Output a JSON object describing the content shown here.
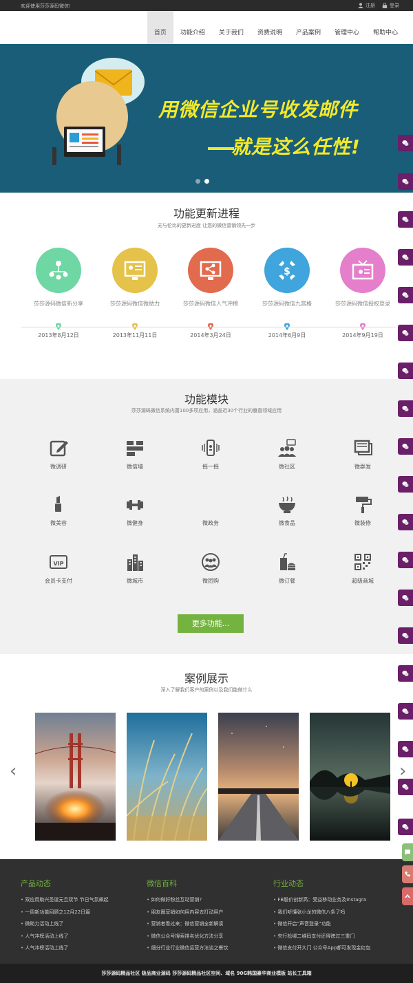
{
  "topbar": {
    "welcome": "欢迎使用莎莎源码微信!",
    "register": "注册",
    "login": "登录"
  },
  "nav": {
    "items": [
      "首页",
      "功能介绍",
      "关于我们",
      "资费说明",
      "产品案例",
      "管理中心",
      "帮助中心"
    ],
    "active": "首页"
  },
  "banner": {
    "line1": "用微信企业号收发邮件",
    "line2": "就是这么任性!",
    "slide_count": 2,
    "active_slide": 2
  },
  "timeline": {
    "title": "功能更新进程",
    "subtitle": "无与伦比的更新进度 让您的微信营销领先一步",
    "items": [
      {
        "label": "莎莎源码微信新分享",
        "date": "2013年8月12日",
        "color": "#6ed7a3",
        "icon": "people-network-icon"
      },
      {
        "label": "莎莎源码微信微助力",
        "date": "2013年11月11日",
        "color": "#e5c24a",
        "icon": "profile-card-icon"
      },
      {
        "label": "莎莎源码微信人气冲榜",
        "date": "2014年3月24日",
        "color": "#e26a4d",
        "icon": "share-screen-icon"
      },
      {
        "label": "莎莎源码微信九宫格",
        "date": "2014年6月9日",
        "color": "#3fa5dc",
        "icon": "dollar-gear-icon"
      },
      {
        "label": "莎莎源码微信授权登录",
        "date": "2014年9月19日",
        "color": "#e57fcb",
        "icon": "tv-o2o-icon"
      }
    ]
  },
  "features": {
    "title": "功能模块",
    "subtitle": "莎莎源码微信系统内置100多项应用，涵盖近30个行业的垂直领域应用",
    "items": [
      {
        "label": "微调研",
        "icon": "survey-edit-icon"
      },
      {
        "label": "微信墙",
        "icon": "wall-blocks-icon"
      },
      {
        "label": "摇一摇",
        "icon": "shake-phone-icon"
      },
      {
        "label": "微社区",
        "icon": "community-icon"
      },
      {
        "label": "微群发",
        "icon": "mass-message-icon"
      },
      {
        "label": "微美容",
        "icon": "lipstick-icon"
      },
      {
        "label": "微健身",
        "icon": "dumbbell-icon"
      },
      {
        "label": "微政务",
        "icon": "government-icon"
      },
      {
        "label": "微食品",
        "icon": "food-bowl-icon"
      },
      {
        "label": "微装修",
        "icon": "paint-roller-icon"
      },
      {
        "label": "会员卡支付",
        "icon": "vip-card-icon"
      },
      {
        "label": "微城市",
        "icon": "city-buildings-icon"
      },
      {
        "label": "微团购",
        "icon": "group-buy-icon"
      },
      {
        "label": "微订餐",
        "icon": "ordering-icon"
      },
      {
        "label": "超级商城",
        "icon": "qr-mall-icon"
      }
    ],
    "more_button": "更多功能..."
  },
  "cases": {
    "title": "案例展示",
    "subtitle": "深入了解我们客户的案例以及我们能做什么",
    "images": [
      "golden-gate-fire",
      "wheat-grass",
      "night-road",
      "lake-tree"
    ]
  },
  "footer": {
    "columns": [
      {
        "title": "产品动态",
        "items": [
          "双应用助兴圣诞元旦双节 节日气氛飙起",
          "一周新功能回顾之12月22日篇",
          "微助力活动上线了",
          "人气冲榜活动上线了",
          "人气冲榜活动上线了"
        ]
      },
      {
        "title": "微信百科",
        "items": [
          "如何做好粉丝互动营销?",
          "朋友圈营销如何用内容去打动用户",
          "营销者看过来：微信营销全新解读",
          "微信公众号搜索排名优化方法分享",
          "细分行业行业微信运营方法谈之餐饮"
        ]
      },
      {
        "title": "行业动态",
        "items": [
          "FB股价创新高：受益移动业务及Instagra",
          "我们听懂张小龙的微信八条了吗",
          "微信开启“声音登录”功能",
          "央行松绑二维码支付还得跨过三重门",
          "微信支付开大门 公众号App都可发现金红包"
        ]
      }
    ],
    "copyright": "莎莎源码精品社区   极品商业源码   莎莎源码精品社区空间、域名   90G韩国豪华商业模板   站长工具箱"
  },
  "colors": {
    "accent_green": "#74b33f",
    "banner_bg": "#1a5d78",
    "side_purple": "#6a1f68"
  }
}
